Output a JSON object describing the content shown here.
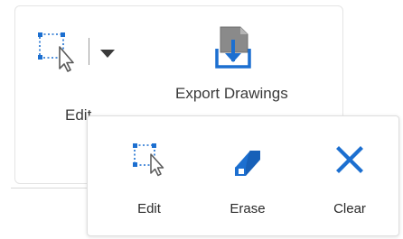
{
  "ribbon": {
    "edit_label": "Edit",
    "export_label": "Export Drawings"
  },
  "dropdown": {
    "items": [
      {
        "label": "Edit",
        "icon": "edit-select-icon"
      },
      {
        "label": "Erase",
        "icon": "eraser-icon"
      },
      {
        "label": "Clear",
        "icon": "close-icon"
      }
    ]
  },
  "colors": {
    "accent_blue": "#1c6fd0",
    "icon_gray": "#6e6e6e",
    "export_gray": "#8a8a8a"
  }
}
